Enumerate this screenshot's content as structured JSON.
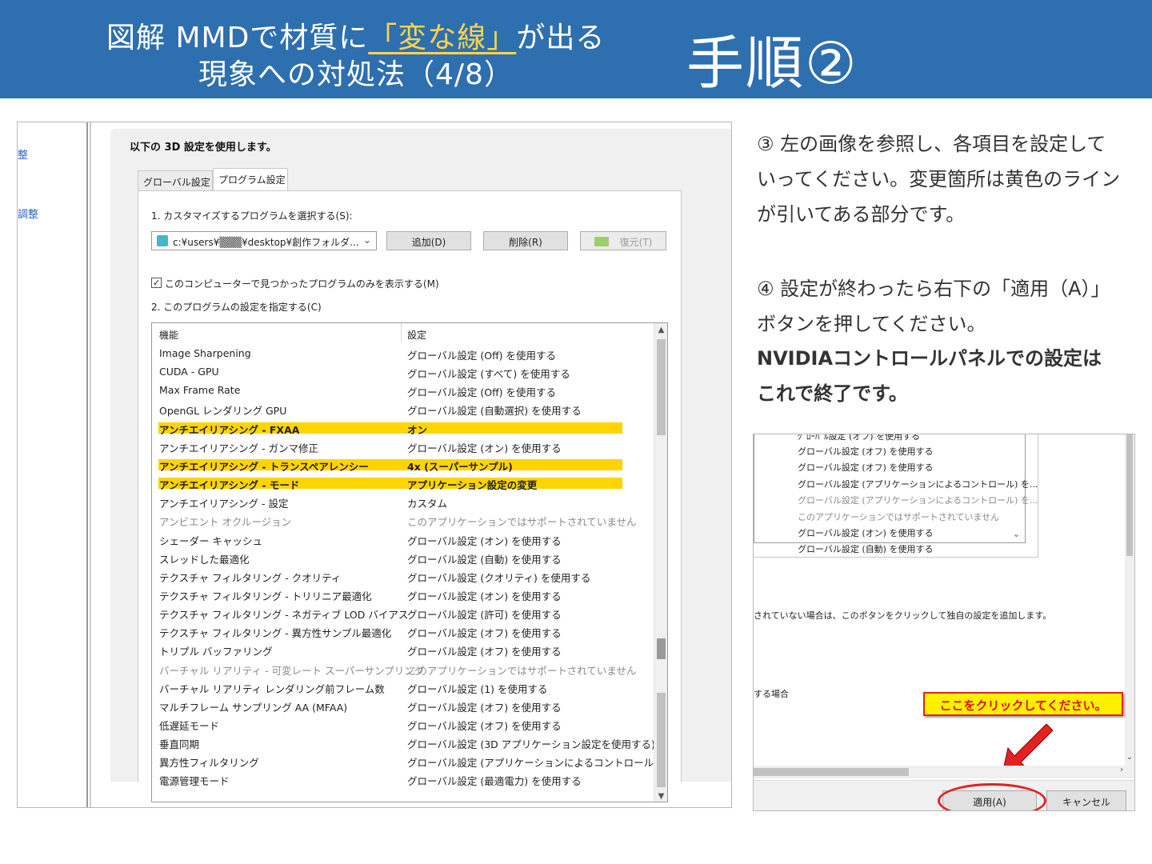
{
  "header": {
    "title_line1_pre": "図解 MMDで材質に",
    "title_line1_hl": "「変な線」",
    "title_line1_post": "が出る",
    "title_line2": "現象への対処法（4/8）",
    "step": "手順②"
  },
  "left_shot": {
    "side_links": [
      "整",
      "調整"
    ],
    "panel_title": "以下の 3D 設定を使用します。",
    "tabs": [
      "グローバル設定",
      "プログラム設定"
    ],
    "active_tab": "プログラム設定",
    "label_select": "1. カスタマイズするプログラムを選択する(S):",
    "program_combo": "c:¥users¥▒▒▒¥desktop¥創作フォルダ...",
    "btn_add": "追加(D)",
    "btn_remove": "削除(R)",
    "btn_restore": "復元(T)",
    "checkbox_label": "このコンピューターで見つかったプログラムのみを表示する(M)",
    "checkbox_mark": "✓",
    "label_settings": "2. このプログラムの設定を指定する(C)",
    "col_feature": "機能",
    "col_setting": "設定",
    "rows": [
      {
        "feature": "Image Sharpening",
        "setting": "グローバル設定 (Off) を使用する",
        "style": ""
      },
      {
        "feature": "CUDA - GPU",
        "setting": "グローバル設定 (すべて) を使用する",
        "style": ""
      },
      {
        "feature": "Max Frame Rate",
        "setting": "グローバル設定 (Off) を使用する",
        "style": ""
      },
      {
        "feature": "OpenGL レンダリング GPU",
        "setting": "グローバル設定 (自動選択) を使用する",
        "style": ""
      },
      {
        "feature": "アンチエイリアシング - FXAA",
        "setting": "オン",
        "style": "hl"
      },
      {
        "feature": "アンチエイリアシング - ガンマ修正",
        "setting": "グローバル設定 (オン) を使用する",
        "style": ""
      },
      {
        "feature": "アンチエイリアシング - トランスペアレンシー",
        "setting": "4x (スーパーサンプル)",
        "style": "hl"
      },
      {
        "feature": "アンチエイリアシング - モード",
        "setting": "アプリケーション設定の変更",
        "style": "hl"
      },
      {
        "feature": "アンチエイリアシング - 設定",
        "setting": "カスタム",
        "style": ""
      },
      {
        "feature": "アンビエント オクルージョン",
        "setting": "このアプリケーションではサポートされていません",
        "style": "dim"
      },
      {
        "feature": "シェーダー キャッシュ",
        "setting": "グローバル設定 (オン) を使用する",
        "style": ""
      },
      {
        "feature": "スレッドした最適化",
        "setting": "グローバル設定 (自動) を使用する",
        "style": ""
      },
      {
        "feature": "テクスチャ フィルタリング - クオリティ",
        "setting": "グローバル設定 (クオリティ) を使用する",
        "style": ""
      },
      {
        "feature": "テクスチャ フィルタリング - トリリニア最適化",
        "setting": "グローバル設定 (オン) を使用する",
        "style": ""
      },
      {
        "feature": "テクスチャ フィルタリング - ネガティブ LOD バイアス",
        "setting": "グローバル設定 (許可) を使用する",
        "style": ""
      },
      {
        "feature": "テクスチャ フィルタリング - 異方性サンプル最適化",
        "setting": "グローバル設定 (オフ) を使用する",
        "style": ""
      },
      {
        "feature": "トリプル バッファリング",
        "setting": "グローバル設定 (オフ) を使用する",
        "style": ""
      },
      {
        "feature": "バーチャル リアリティ - 可変レート スーパーサンプリング",
        "setting": "このアプリケーションではサポートされていません",
        "style": "dim"
      },
      {
        "feature": "バーチャル リアリティ レンダリング前フレーム数",
        "setting": "グローバル設定 (1) を使用する",
        "style": ""
      },
      {
        "feature": "マルチフレーム サンプリング AA (MFAA)",
        "setting": "グローバル設定 (オフ) を使用する",
        "style": ""
      },
      {
        "feature": "低遅延モード",
        "setting": "グローバル設定 (オフ) を使用する",
        "style": ""
      },
      {
        "feature": "垂直同期",
        "setting": "グローバル設定 (3D アプリケーション設定を使用する) ...",
        "style": ""
      },
      {
        "feature": "異方性フィルタリング",
        "setting": "グローバル設定 (アプリケーションによるコントロール) を...",
        "style": ""
      },
      {
        "feature": "電源管理モード",
        "setting": "グローバル設定 (最適電力) を使用する",
        "style": ""
      }
    ]
  },
  "instructions": {
    "step3": [
      "③ 左の画像を参照し、各項目を設定して",
      "いってください。変更箇所は黄色のライン",
      "が引いてある部分です。"
    ],
    "step4": [
      "④ 設定が終わったら右下の「適用（A）」",
      "ボタンを押してください。"
    ],
    "step4_bold": [
      "NVIDIAコントロールパネルでの設定は",
      "これで終了です。"
    ]
  },
  "right_shot": {
    "list_lines": [
      {
        "text": "グローバル設定 (オフ) を使用する",
        "style": ""
      },
      {
        "text": "グローバル設定 (オフ) を使用する",
        "style": ""
      },
      {
        "text": "グローバル設定 (アプリケーションによるコントロール) を...",
        "style": ""
      },
      {
        "text": "グローバル設定 (アプリケーションによるコントロール) を...",
        "style": "dim"
      },
      {
        "text": "このアプリケーションではサポートされていません",
        "style": "dim"
      },
      {
        "text": "グローバル設定 (オン) を使用する",
        "style": ""
      },
      {
        "text": "グローバル設定 (自動) を使用する",
        "style": ""
      }
    ],
    "text1": "されていない場合は、このボタンをクリックして独自の設定を追加します。",
    "text2": "する場合",
    "callout": "ここをクリックしてください。",
    "btn_apply": "適用(A)",
    "btn_cancel": "キャンセル"
  },
  "colors": {
    "header_bg": "#2e6fb0",
    "title_highlight": "#ffd54a",
    "row_highlight": "#ffd400",
    "callout_bg": "#ffef00",
    "callout_red": "#e32222"
  }
}
